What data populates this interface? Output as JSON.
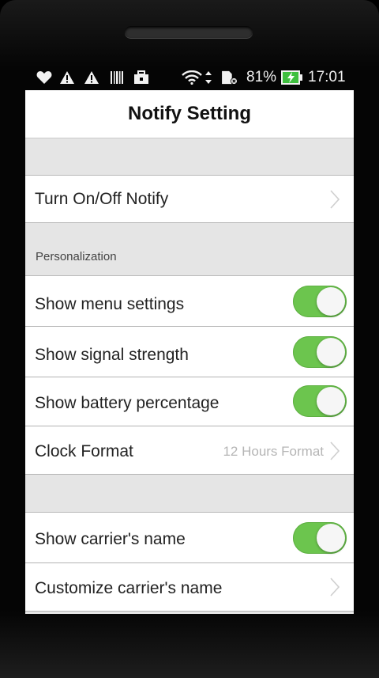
{
  "statusbar": {
    "battery_pct": "81%",
    "time": "17:01",
    "icons": [
      "heart-icon",
      "warning-icon",
      "warning-icon",
      "barcode-icon",
      "briefcase-icon",
      "wifi-icon",
      "data-arrows-icon",
      "sd-card-icon",
      "battery-charging-icon"
    ]
  },
  "header": {
    "title": "Notify Setting"
  },
  "rows": {
    "turn_on_off": "Turn On/Off Notify",
    "personalization_header": "Personalization",
    "show_menu": "Show menu settings",
    "show_signal": "Show signal strength",
    "show_battery": "Show battery percentage",
    "clock_format": "Clock Format",
    "clock_format_value": "12 Hours Format",
    "show_carrier": "Show carrier's name",
    "customize_carrier": "Customize carrier's name"
  },
  "toggles": {
    "show_menu": true,
    "show_signal": true,
    "show_battery": true,
    "show_carrier": true
  },
  "colors": {
    "toggle_on": "#6cc54e",
    "section_bg": "#e5e5e5",
    "battery": "#3fbf3f"
  }
}
